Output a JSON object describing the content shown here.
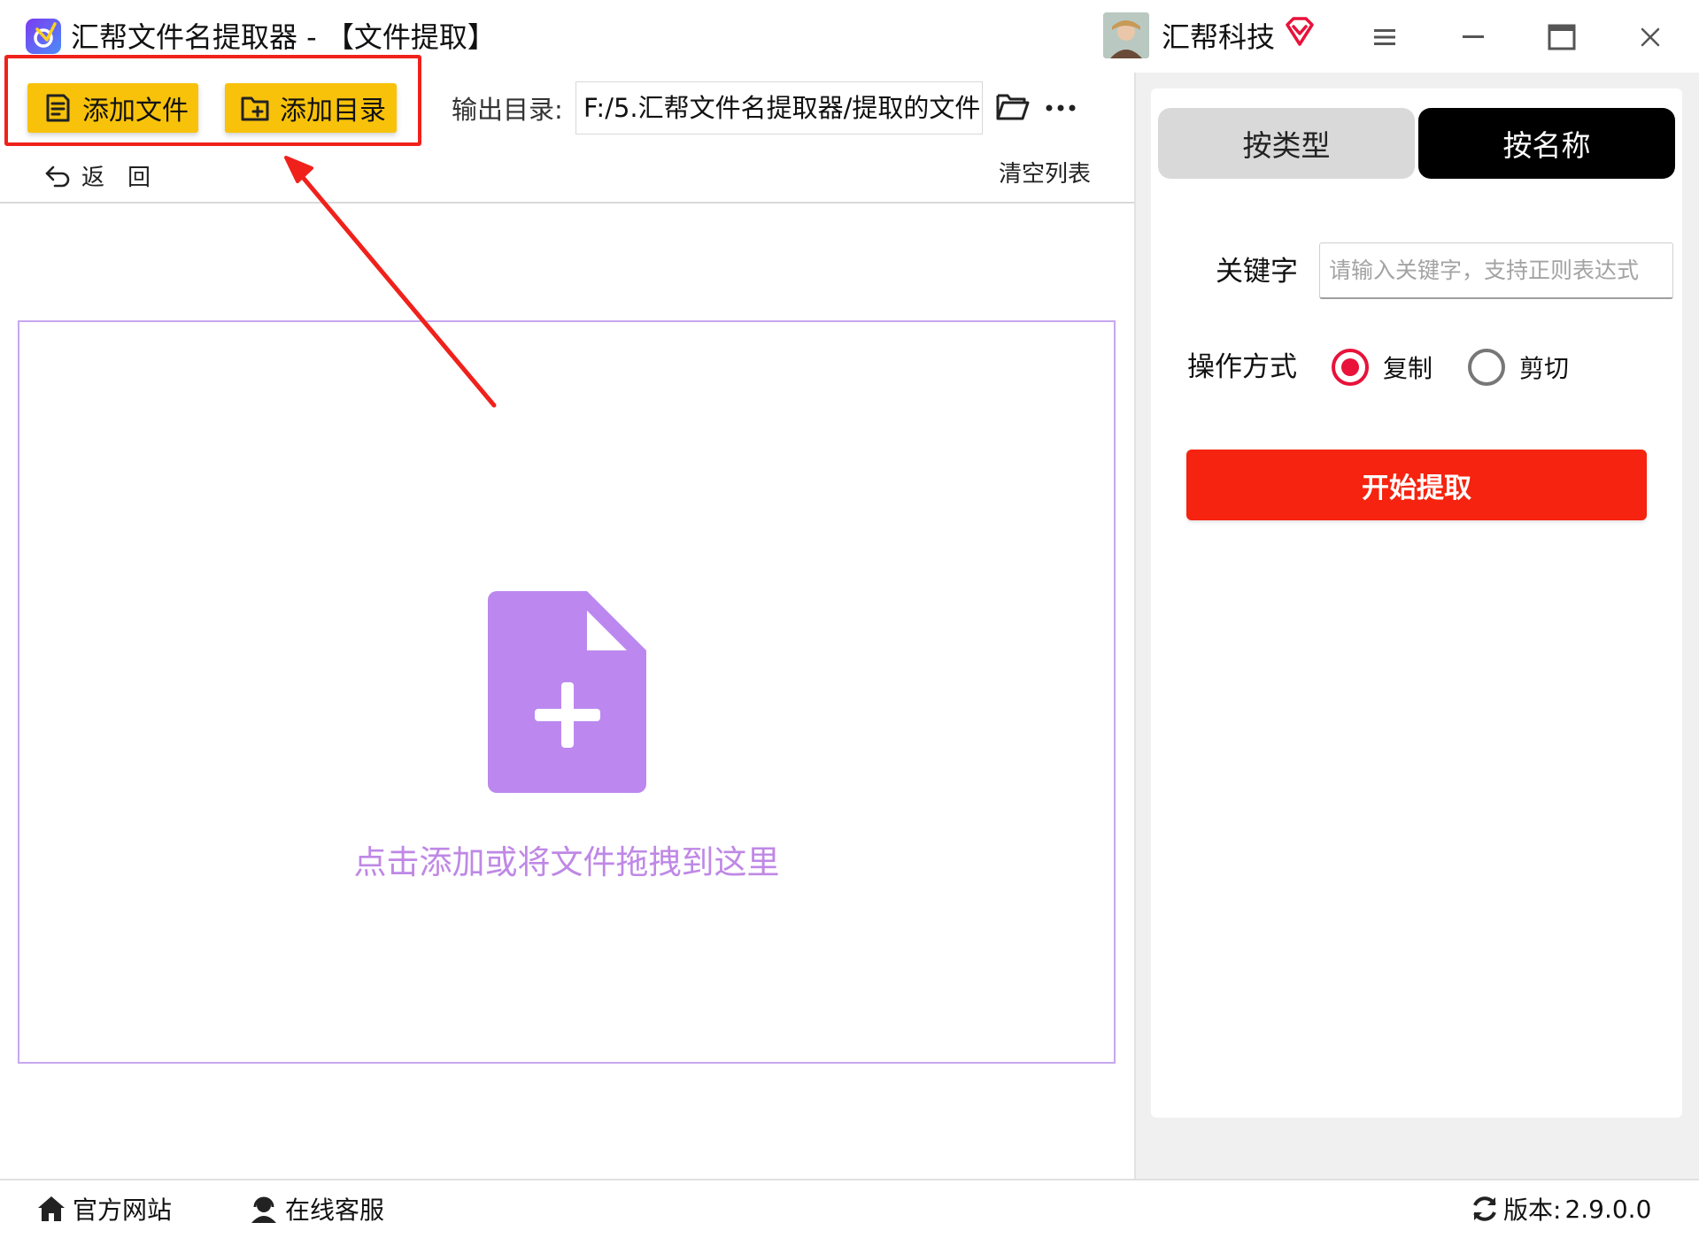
{
  "window": {
    "app_title": "汇帮文件名提取器 - 【文件提取】",
    "brand_name": "汇帮科技"
  },
  "toolbar": {
    "add_file_label": "添加文件",
    "add_folder_label": "添加目录",
    "output_label": "输出目录:",
    "output_path": "F:/5.汇帮文件名提取器/提取的文件",
    "back_label": "返回",
    "clear_label": "清空列表"
  },
  "dropzone": {
    "hint": "点击添加或将文件拖拽到这里"
  },
  "right_panel": {
    "tabs": [
      {
        "label": "按类型",
        "active": false
      },
      {
        "label": "按名称",
        "active": true
      }
    ],
    "keyword_label": "关键字",
    "keyword_value": "",
    "keyword_placeholder": "请输入关键字，支持正则表达式",
    "operation_label": "操作方式",
    "operation_options": [
      {
        "label": "复制",
        "selected": true
      },
      {
        "label": "剪切",
        "selected": false
      }
    ],
    "start_label": "开始提取"
  },
  "footer": {
    "website_label": "官方网站",
    "support_label": "在线客服",
    "version_label": "版本:",
    "version_value": "2.9.0.0"
  },
  "colors": {
    "accent_yellow": "#f8c20a",
    "start_red": "#f5230f",
    "radio_red": "#e8123a",
    "drop_purple": "#bf88e6",
    "annotation_red": "#f0211b",
    "active_tab": "#000000"
  },
  "icons": {
    "app_logo": "app-logo-icon",
    "vip": "vip-diamond-icon",
    "menu": "hamburger-menu-icon",
    "minimize": "minimize-icon",
    "maximize": "maximize-icon",
    "close": "close-icon",
    "add_file": "file-list-icon",
    "add_folder": "folder-add-icon",
    "open_folder": "folder-open-icon",
    "more": "more-dots-icon",
    "back": "undo-arrow-icon",
    "drop": "file-plus-icon",
    "home": "home-icon",
    "support": "headset-user-icon",
    "refresh": "refresh-icon"
  }
}
